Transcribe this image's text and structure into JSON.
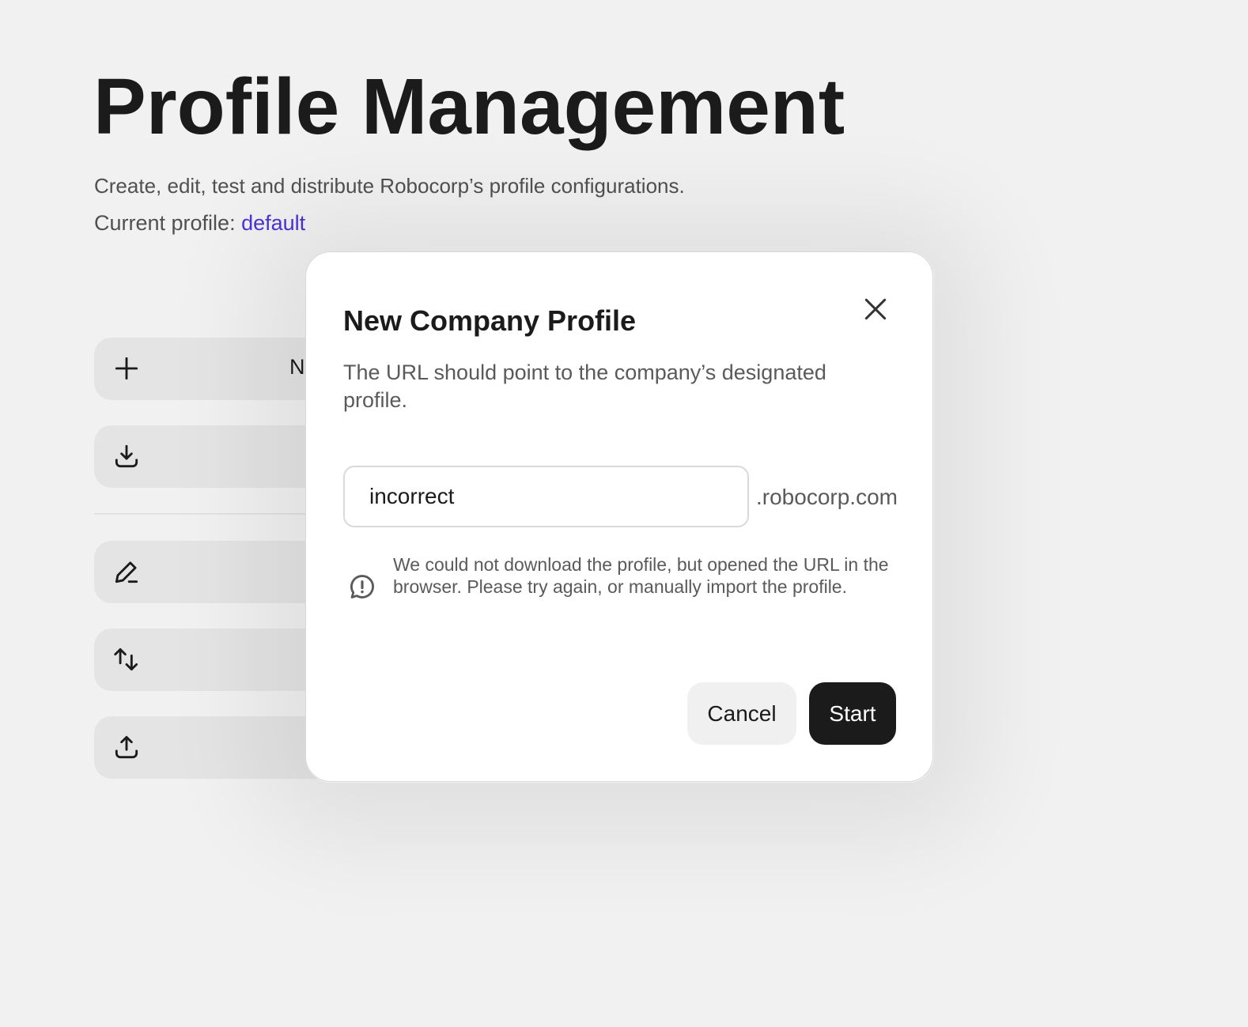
{
  "header": {
    "title": "Profile Management",
    "subtitle": "Create, edit, test and distribute Robocorp’s profile configurations.",
    "current_profile_label": "Current profile:",
    "current_profile_value": "default"
  },
  "actions": [
    {
      "icon": "plus-icon",
      "label": "N"
    },
    {
      "icon": "download-icon",
      "label": ""
    },
    {
      "icon": "edit-icon",
      "label": ""
    },
    {
      "icon": "switch-icon",
      "label": ""
    },
    {
      "icon": "upload-icon",
      "label": ""
    }
  ],
  "dialog": {
    "title": "New Company Profile",
    "description": "The URL should point to the company’s designated profile.",
    "input_value": "incorrect",
    "suffix": ".robocorp.com",
    "error_message": "We could not download the profile, but opened the URL in the browser. Please try again, or manually import the profile.",
    "cancel_label": "Cancel",
    "start_label": "Start"
  },
  "colors": {
    "accent_link": "#4b32d6",
    "primary_button": "#1b1b1b",
    "background": "#f1f1f1"
  }
}
